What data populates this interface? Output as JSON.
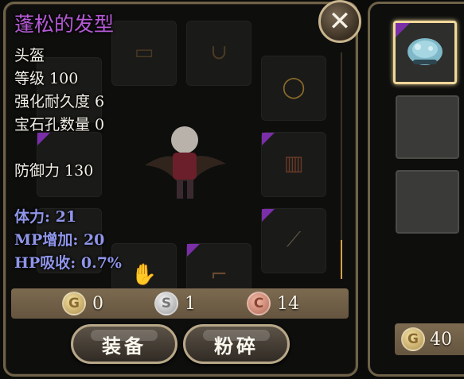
{
  "item": {
    "name": "蓬松的发型",
    "type": "头盔",
    "level": "等级 100",
    "durability": "强化耐久度 6",
    "gem_slots": "宝石孔数量 0",
    "defense": "防御力 130",
    "stats": [
      "体力: 21",
      "MP增加: 20",
      "HP吸收: 0.7%"
    ]
  },
  "currency": {
    "gold": "0",
    "silver": "1",
    "copper": "14",
    "gold_icon_letter": "G",
    "silver_icon_letter": "S",
    "copper_icon_letter": "C"
  },
  "buttons": {
    "equip": "装备",
    "shatter": "粉碎",
    "close_glyph": "✕"
  },
  "side_panel": {
    "gold": "40"
  },
  "colors": {
    "item_name": "#b65ad6",
    "stat_text": "#8f95e8",
    "rarity_purple": "#7a2ea8",
    "frame": "#6f6248"
  },
  "icons": [
    "close-icon",
    "gold-coin-icon",
    "silver-coin-icon",
    "copper-coin-icon",
    "helmet-icon",
    "necklace-icon",
    "ring-icon",
    "armor-icon",
    "weapon-icon",
    "gloves-icon",
    "boots-icon"
  ]
}
